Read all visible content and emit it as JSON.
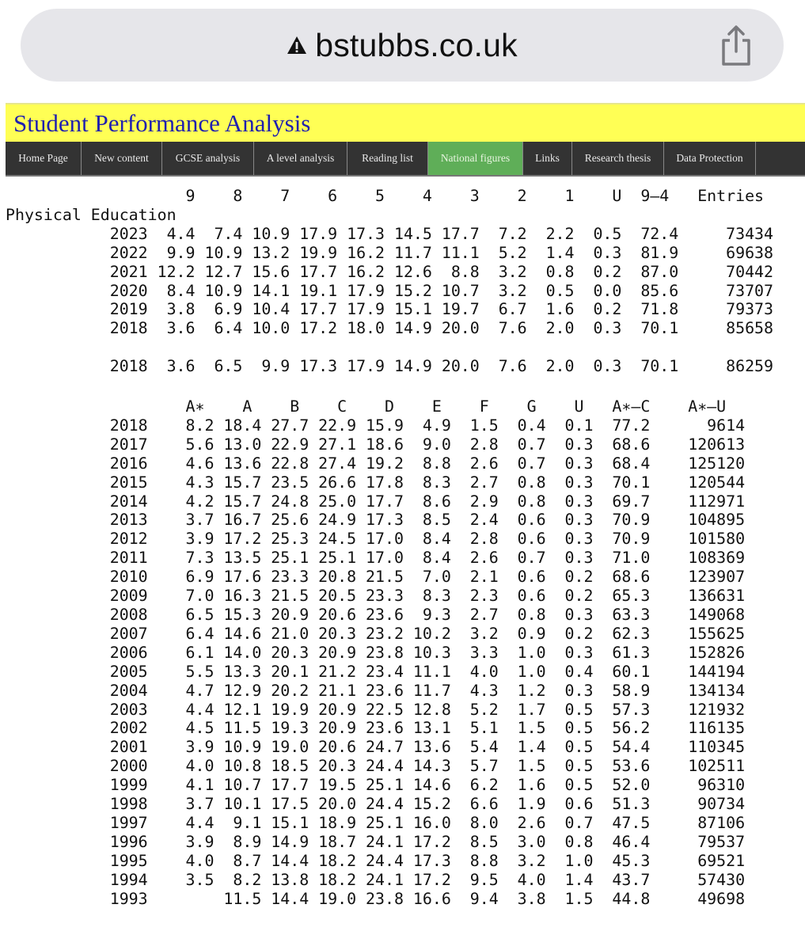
{
  "browser": {
    "url": "bstubbs.co.uk",
    "security_icon": "warning-icon",
    "share_icon": "share-icon"
  },
  "site": {
    "title": "Student Performance Analysis",
    "colors": {
      "header_bg": "#ffff55",
      "title": "#1f1fb0",
      "nav_bg": "#333333",
      "nav_active": "#5fae58"
    }
  },
  "nav": {
    "items": [
      {
        "label": "Home Page",
        "active": false
      },
      {
        "label": "New content",
        "active": false
      },
      {
        "label": "GCSE analysis",
        "active": false
      },
      {
        "label": "A level analysis",
        "active": false
      },
      {
        "label": "Reading list",
        "active": false
      },
      {
        "label": "National figures",
        "active": true
      },
      {
        "label": "Links",
        "active": false
      },
      {
        "label": "Research thesis",
        "active": false
      },
      {
        "label": "Data Protection",
        "active": false
      }
    ]
  },
  "gcse": {
    "subject": "Physical Education",
    "headers": [
      "9",
      "8",
      "7",
      "6",
      "5",
      "4",
      "3",
      "2",
      "1",
      "U",
      "9-4",
      "Entries"
    ],
    "rows": [
      {
        "year": "2023",
        "values": [
          "4.4",
          "7.4",
          "10.9",
          "17.9",
          "17.3",
          "14.5",
          "17.7",
          "7.2",
          "2.2",
          "0.5",
          "72.4",
          "73434"
        ]
      },
      {
        "year": "2022",
        "values": [
          "9.9",
          "10.9",
          "13.2",
          "19.9",
          "16.2",
          "11.7",
          "11.1",
          "5.2",
          "1.4",
          "0.3",
          "81.9",
          "69638"
        ]
      },
      {
        "year": "2021",
        "values": [
          "12.2",
          "12.7",
          "15.6",
          "17.7",
          "16.2",
          "12.6",
          "8.8",
          "3.2",
          "0.8",
          "0.2",
          "87.0",
          "70442"
        ]
      },
      {
        "year": "2020",
        "values": [
          "8.4",
          "10.9",
          "14.1",
          "19.1",
          "17.9",
          "15.2",
          "10.7",
          "3.2",
          "0.5",
          "0.0",
          "85.6",
          "73707"
        ]
      },
      {
        "year": "2019",
        "values": [
          "3.8",
          "6.9",
          "10.4",
          "17.7",
          "17.9",
          "15.1",
          "19.7",
          "6.7",
          "1.6",
          "0.2",
          "71.8",
          "79373"
        ]
      },
      {
        "year": "2018",
        "values": [
          "3.6",
          "6.4",
          "10.0",
          "17.2",
          "18.0",
          "14.9",
          "20.0",
          "7.6",
          "2.0",
          "0.3",
          "70.1",
          "85658"
        ]
      }
    ],
    "extra_row": {
      "year": "2018",
      "values": [
        "3.6",
        "6.5",
        "9.9",
        "17.3",
        "17.9",
        "14.9",
        "20.0",
        "7.6",
        "2.0",
        "0.3",
        "70.1",
        "86259"
      ]
    }
  },
  "legacy": {
    "headers": [
      "A*",
      "A",
      "B",
      "C",
      "D",
      "E",
      "F",
      "G",
      "U",
      "A*-C",
      "A*-U"
    ],
    "rows": [
      {
        "year": "2018",
        "values": [
          "8.2",
          "18.4",
          "27.7",
          "22.9",
          "15.9",
          "4.9",
          "1.5",
          "0.4",
          "0.1",
          "77.2",
          "9614"
        ]
      },
      {
        "year": "2017",
        "values": [
          "5.6",
          "13.0",
          "22.9",
          "27.1",
          "18.6",
          "9.0",
          "2.8",
          "0.7",
          "0.3",
          "68.6",
          "120613"
        ]
      },
      {
        "year": "2016",
        "values": [
          "4.6",
          "13.6",
          "22.8",
          "27.4",
          "19.2",
          "8.8",
          "2.6",
          "0.7",
          "0.3",
          "68.4",
          "125120"
        ]
      },
      {
        "year": "2015",
        "values": [
          "4.3",
          "15.7",
          "23.5",
          "26.6",
          "17.8",
          "8.3",
          "2.7",
          "0.8",
          "0.3",
          "70.1",
          "120544"
        ]
      },
      {
        "year": "2014",
        "values": [
          "4.2",
          "15.7",
          "24.8",
          "25.0",
          "17.7",
          "8.6",
          "2.9",
          "0.8",
          "0.3",
          "69.7",
          "112971"
        ]
      },
      {
        "year": "2013",
        "values": [
          "3.7",
          "16.7",
          "25.6",
          "24.9",
          "17.3",
          "8.5",
          "2.4",
          "0.6",
          "0.3",
          "70.9",
          "104895"
        ]
      },
      {
        "year": "2012",
        "values": [
          "3.9",
          "17.2",
          "25.3",
          "24.5",
          "17.0",
          "8.4",
          "2.8",
          "0.6",
          "0.3",
          "70.9",
          "101580"
        ]
      },
      {
        "year": "2011",
        "values": [
          "7.3",
          "13.5",
          "25.1",
          "25.1",
          "17.0",
          "8.4",
          "2.6",
          "0.7",
          "0.3",
          "71.0",
          "108369"
        ]
      },
      {
        "year": "2010",
        "values": [
          "6.9",
          "17.6",
          "23.3",
          "20.8",
          "21.5",
          "7.0",
          "2.1",
          "0.6",
          "0.2",
          "68.6",
          "123907"
        ]
      },
      {
        "year": "2009",
        "values": [
          "7.0",
          "16.3",
          "21.5",
          "20.5",
          "23.3",
          "8.3",
          "2.3",
          "0.6",
          "0.2",
          "65.3",
          "136631"
        ]
      },
      {
        "year": "2008",
        "values": [
          "6.5",
          "15.3",
          "20.9",
          "20.6",
          "23.6",
          "9.3",
          "2.7",
          "0.8",
          "0.3",
          "63.3",
          "149068"
        ]
      },
      {
        "year": "2007",
        "values": [
          "6.4",
          "14.6",
          "21.0",
          "20.3",
          "23.2",
          "10.2",
          "3.2",
          "0.9",
          "0.2",
          "62.3",
          "155625"
        ]
      },
      {
        "year": "2006",
        "values": [
          "6.1",
          "14.0",
          "20.3",
          "20.9",
          "23.8",
          "10.3",
          "3.3",
          "1.0",
          "0.3",
          "61.3",
          "152826"
        ]
      },
      {
        "year": "2005",
        "values": [
          "5.5",
          "13.3",
          "20.1",
          "21.2",
          "23.4",
          "11.1",
          "4.0",
          "1.0",
          "0.4",
          "60.1",
          "144194"
        ]
      },
      {
        "year": "2004",
        "values": [
          "4.7",
          "12.9",
          "20.2",
          "21.1",
          "23.6",
          "11.7",
          "4.3",
          "1.2",
          "0.3",
          "58.9",
          "134134"
        ]
      },
      {
        "year": "2003",
        "values": [
          "4.4",
          "12.1",
          "19.9",
          "20.9",
          "22.5",
          "12.8",
          "5.2",
          "1.7",
          "0.5",
          "57.3",
          "121932"
        ]
      },
      {
        "year": "2002",
        "values": [
          "4.5",
          "11.5",
          "19.3",
          "20.9",
          "23.6",
          "13.1",
          "5.1",
          "1.5",
          "0.5",
          "56.2",
          "116135"
        ]
      },
      {
        "year": "2001",
        "values": [
          "3.9",
          "10.9",
          "19.0",
          "20.6",
          "24.7",
          "13.6",
          "5.4",
          "1.4",
          "0.5",
          "54.4",
          "110345"
        ]
      },
      {
        "year": "2000",
        "values": [
          "4.0",
          "10.8",
          "18.5",
          "20.3",
          "24.4",
          "14.3",
          "5.7",
          "1.5",
          "0.5",
          "53.6",
          "102511"
        ]
      },
      {
        "year": "1999",
        "values": [
          "4.1",
          "10.7",
          "17.7",
          "19.5",
          "25.1",
          "14.6",
          "6.2",
          "1.6",
          "0.5",
          "52.0",
          "96310"
        ]
      },
      {
        "year": "1998",
        "values": [
          "3.7",
          "10.1",
          "17.5",
          "20.0",
          "24.4",
          "15.2",
          "6.6",
          "1.9",
          "0.6",
          "51.3",
          "90734"
        ]
      },
      {
        "year": "1997",
        "values": [
          "4.4",
          "9.1",
          "15.1",
          "18.9",
          "25.1",
          "16.0",
          "8.0",
          "2.6",
          "0.7",
          "47.5",
          "87106"
        ]
      },
      {
        "year": "1996",
        "values": [
          "3.9",
          "8.9",
          "14.9",
          "18.7",
          "24.1",
          "17.2",
          "8.5",
          "3.0",
          "0.8",
          "46.4",
          "79537"
        ]
      },
      {
        "year": "1995",
        "values": [
          "4.0",
          "8.7",
          "14.4",
          "18.2",
          "24.4",
          "17.3",
          "8.8",
          "3.2",
          "1.0",
          "45.3",
          "69521"
        ]
      },
      {
        "year": "1994",
        "values": [
          "3.5",
          "8.2",
          "13.8",
          "18.2",
          "24.1",
          "17.2",
          "9.5",
          "4.0",
          "1.4",
          "43.7",
          "57430"
        ]
      },
      {
        "year": "1993",
        "values": [
          "",
          "11.5",
          "14.4",
          "19.0",
          "23.8",
          "16.6",
          "9.4",
          "3.8",
          "1.5",
          "44.8",
          "49698"
        ]
      }
    ]
  }
}
